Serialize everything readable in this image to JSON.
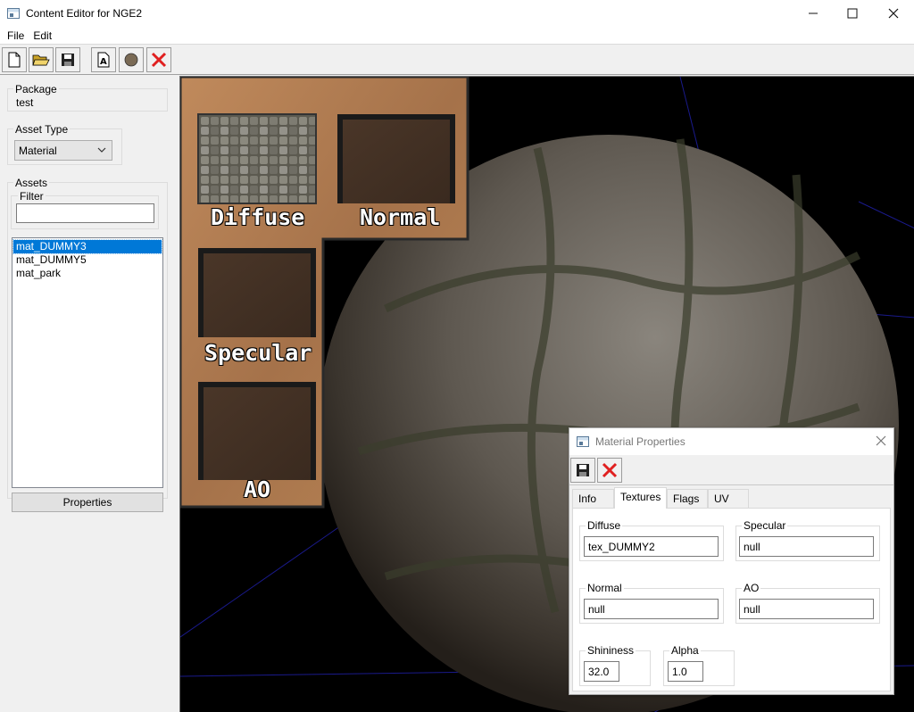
{
  "window": {
    "title": "Content Editor for NGE2",
    "controls": [
      "minimize-icon",
      "maximize-icon",
      "close-icon"
    ]
  },
  "menu": {
    "items": [
      "File",
      "Edit"
    ]
  },
  "toolbar": {
    "buttons": [
      "new-file-icon",
      "open-folder-icon",
      "save-icon",
      "rename-asset-icon",
      "sphere-preview-icon",
      "delete-icon"
    ]
  },
  "sidebar": {
    "package_label": "Package",
    "package_value": "test",
    "asset_type_label": "Asset Type",
    "asset_type_value": "Material",
    "assets_label": "Assets",
    "filter_label": "Filter",
    "filter_value": "",
    "assets": [
      "mat_DUMMY3",
      "mat_DUMMY5",
      "mat_park"
    ],
    "selected_asset": "mat_DUMMY3",
    "properties_button": "Properties"
  },
  "viewport": {
    "texture_labels": {
      "diffuse": "Diffuse",
      "normal": "Normal",
      "specular": "Specular",
      "ao": "AO"
    }
  },
  "dialog": {
    "title": "Material Properties",
    "tabs": [
      "Info",
      "Textures",
      "Flags",
      "UV"
    ],
    "active_tab": "Textures",
    "fields": {
      "diffuse_label": "Diffuse",
      "diffuse_value": "tex_DUMMY2",
      "specular_label": "Specular",
      "specular_value": "null",
      "normal_label": "Normal",
      "normal_value": "null",
      "ao_label": "AO",
      "ao_value": "null",
      "shininess_label": "Shininess",
      "shininess_value": "32.0",
      "alpha_label": "Alpha",
      "alpha_value": "1.0"
    }
  },
  "colors": {
    "selection": "#0078d7",
    "delete_red": "#e02020",
    "grid_line": "#1a1a8c",
    "panel_copper": "#b07a4f"
  }
}
